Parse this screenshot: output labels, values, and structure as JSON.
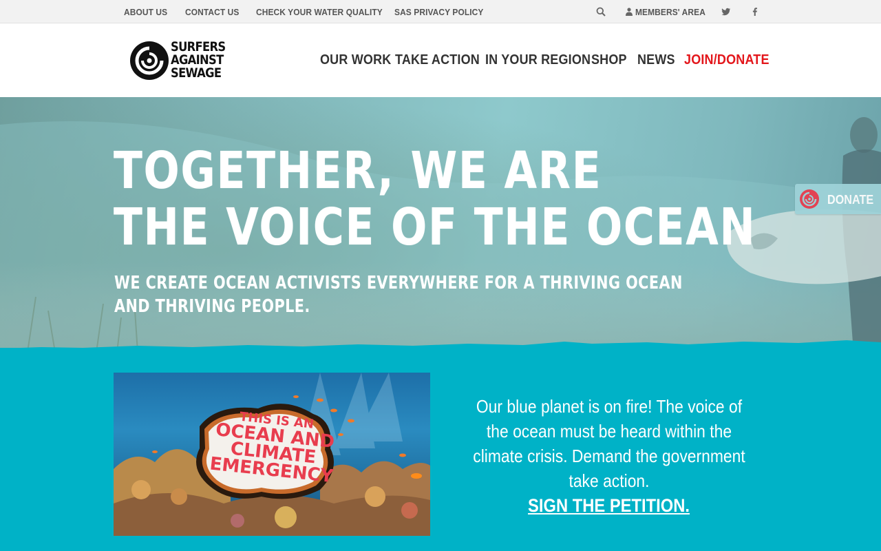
{
  "top_bar": {
    "links": [
      "ABOUT US",
      "CONTACT US",
      "CHECK YOUR WATER QUALITY",
      "SAS PRIVACY POLICY"
    ],
    "members_label": "MEMBERS' AREA",
    "icons": [
      "search-icon",
      "user-icon",
      "twitter-icon",
      "facebook-icon"
    ]
  },
  "logo": {
    "lines": [
      "SURFERS",
      "AGAINST",
      "SEWAGE"
    ]
  },
  "nav": {
    "items": [
      "OUR WORK",
      "TAKE ACTION",
      "IN YOUR REGION",
      "SHOP",
      "NEWS"
    ],
    "cta": "JOIN/DONATE",
    "cta_color": "#e3161b"
  },
  "hero": {
    "title_line1": "TOGETHER, WE ARE",
    "title_line2": "THE VOICE OF THE OCEAN",
    "subtitle": "WE CREATE OCEAN ACTIVISTS EVERYWHERE FOR A THRIVING OCEAN AND THRIVING PEOPLE."
  },
  "donate_tab": {
    "label": "DONATE"
  },
  "campaign": {
    "image_text": [
      "THIS IS AN",
      "OCEAN AND",
      "CLIMATE",
      "EMERGENCY"
    ],
    "body": "Our blue planet is on fire! The voice of the ocean must be heard within the climate crisis. Demand the government take action.",
    "link": "SIGN THE PETITION."
  },
  "colors": {
    "teal": "#00b2c7",
    "accent_red": "#e3161b",
    "util_bar": "#f2f2f2"
  }
}
